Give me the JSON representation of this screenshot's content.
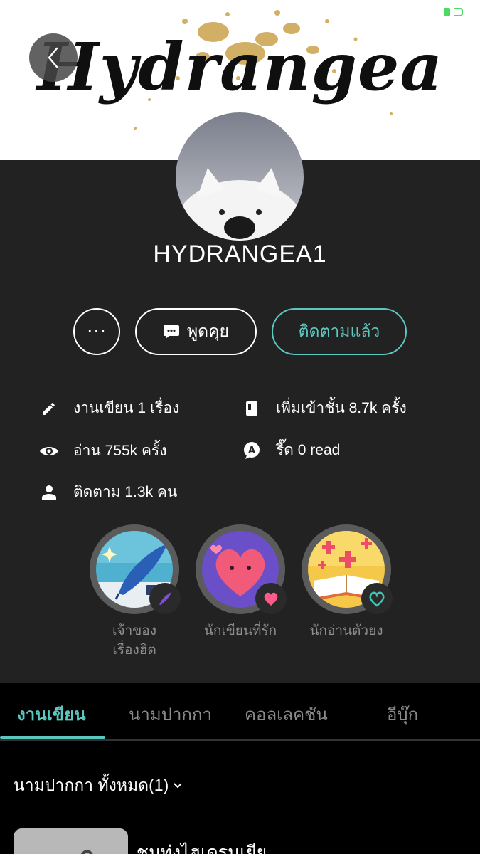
{
  "header": {
    "banner_title": "Hydrangea",
    "back_icon": "chevron-left-icon",
    "battery_color": "#4cd964"
  },
  "profile": {
    "username": "HYDRANGEA1",
    "avatar_icon": "dog-avatar",
    "actions": {
      "more_label": "···",
      "chat_label": "พูดคุย",
      "follow_label": "ติดตามแล้ว"
    },
    "stats": {
      "works": "งานเขียน 1 เรื่อง",
      "shelf_adds": "เพิ่มเข้าชั้น 8.7k ครั้ง",
      "reads": "อ่าน 755k ครั้ง",
      "read_count": "รี๊ด 0 read",
      "followers": "ติดตาม 1.3k คน"
    },
    "badges": [
      {
        "label_line1": "เจ้าของ",
        "label_line2": "เรื่องฮิต",
        "icon": "quill-pen-icon"
      },
      {
        "label_line1": "นักเขียนที่รัก",
        "label_line2": "",
        "icon": "heart-icon"
      },
      {
        "label_line1": "นักอ่านตัวยง",
        "label_line2": "",
        "icon": "open-book-icon"
      }
    ]
  },
  "tabs": [
    {
      "label": "งานเขียน",
      "active": true
    },
    {
      "label": "นามปากกา",
      "active": false
    },
    {
      "label": "คอลเลคชัน",
      "active": false
    },
    {
      "label": "อีบุ๊ก",
      "active": false
    }
  ],
  "filter": {
    "label": "นามปากกา ทั้งหมด(1)"
  },
  "story": {
    "title": "ชุมทุ่งไฮเดรนเยีย"
  },
  "colors": {
    "accent": "#5bc8c0",
    "card_bg": "#222222",
    "page_bg": "#000000"
  }
}
